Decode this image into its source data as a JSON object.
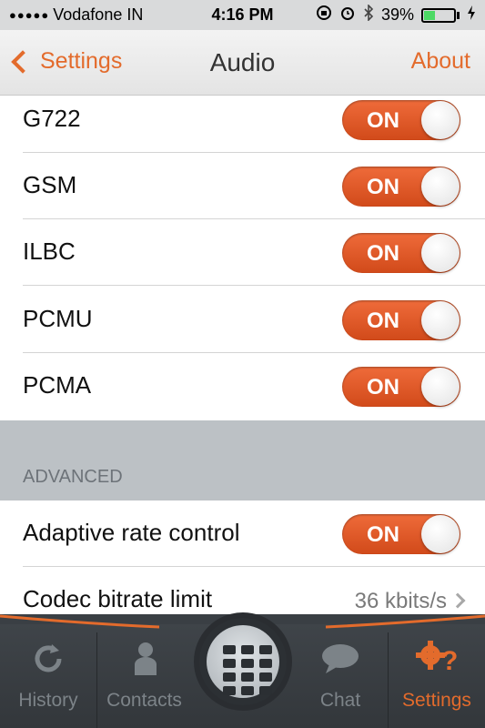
{
  "status_bar": {
    "carrier": "Vodafone IN",
    "time": "4:16 PM",
    "battery_percent": "39%",
    "battery_level": 0.39
  },
  "nav": {
    "back_label": "Settings",
    "title": "Audio",
    "right_label": "About"
  },
  "codecs": [
    {
      "label": "G722",
      "toggle": "ON"
    },
    {
      "label": "GSM",
      "toggle": "ON"
    },
    {
      "label": "ILBC",
      "toggle": "ON"
    },
    {
      "label": "PCMU",
      "toggle": "ON"
    },
    {
      "label": "PCMA",
      "toggle": "ON"
    }
  ],
  "advanced": {
    "header": "ADVANCED",
    "adaptive_rate": {
      "label": "Adaptive rate control",
      "toggle": "ON"
    },
    "bitrate": {
      "label": "Codec bitrate limit",
      "value": "36 kbits/s"
    }
  },
  "tabs": [
    {
      "label": "History",
      "icon": "history-icon",
      "active": false
    },
    {
      "label": "Contacts",
      "icon": "contacts-icon",
      "active": false
    },
    {
      "label": "",
      "icon": "dialpad-icon",
      "active": false
    },
    {
      "label": "Chat",
      "icon": "chat-icon",
      "active": false
    },
    {
      "label": "Settings",
      "icon": "settings-icon",
      "active": true
    }
  ],
  "colors": {
    "accent": "#e36b2c",
    "toggle_on": "#e05a28",
    "group_bg": "#bcc1c5",
    "tabbar_bg": "#3a3f44"
  }
}
